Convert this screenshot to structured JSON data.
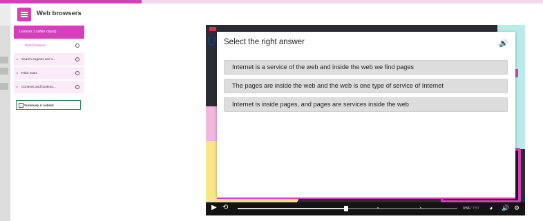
{
  "app": {
    "title": "Web browsers",
    "progress_percent": 26
  },
  "sidebar": {
    "lesson_title": "Lesson 1 (after class)",
    "items": [
      {
        "label": "Web browsers",
        "active": true
      },
      {
        "label": "Search engines and s...",
        "active": false
      },
      {
        "label": "Fake news",
        "active": false
      },
      {
        "label": "Contents and bookma...",
        "active": false
      }
    ],
    "summary_label": "Summary & submit"
  },
  "quiz": {
    "question": "Select the right answer",
    "options": [
      "Internet is a service of the web and inside the web we find pages",
      "The pages are inside the web and the web is one type of service of Internet",
      "Internet is inside pages, and pages are services inside the web"
    ]
  },
  "player": {
    "logo_text": "U",
    "current_time": "3:56",
    "separator": "/",
    "duration": "7:57",
    "icons": [
      "play-icon",
      "replay-icon",
      "speed-icon",
      "volume-icon",
      "settings-icon"
    ]
  },
  "colors": {
    "accent": "#d63ebc",
    "summary_border": "#2d8a5a"
  }
}
